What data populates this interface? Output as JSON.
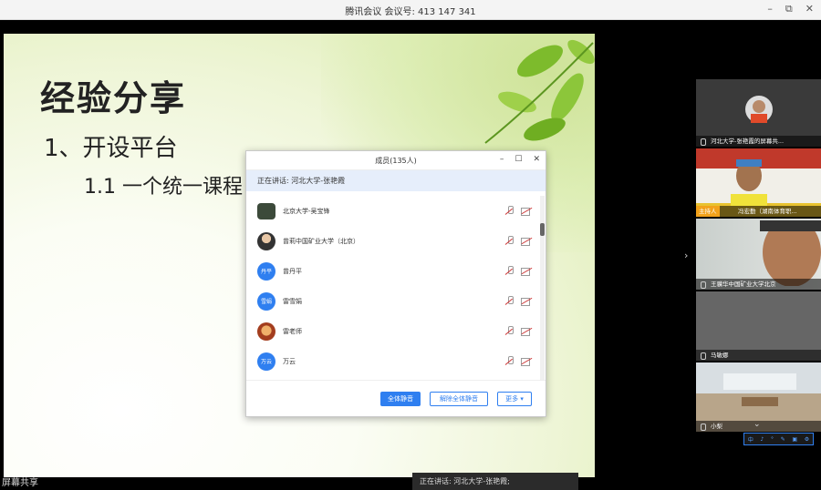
{
  "titlebar": {
    "title": "腾讯会议 会议号: 413 147 341",
    "minimize": "–",
    "restore": "⧉",
    "close": "✕"
  },
  "slide": {
    "heading": "经验分享",
    "line1": "1、开设平台",
    "line2": "1.1 一个统一课程"
  },
  "share_label": "屏幕共享",
  "speaking_bar": "正在讲话: 河北大学-张艳霞;",
  "members_panel": {
    "title": "成员(135人)",
    "speaking": "正在讲话: 河北大学-张艳霞",
    "members": [
      {
        "name": "北京大学-吴宝锋",
        "avatar": "photo1",
        "avatar_text": ""
      },
      {
        "name": "曾莉中国矿业大学（北京）",
        "avatar": "photo2",
        "avatar_text": ""
      },
      {
        "name": "曾丹平",
        "avatar": "blue",
        "avatar_text": "丹平"
      },
      {
        "name": "雷雪娟",
        "avatar": "blue",
        "avatar_text": "雪娟"
      },
      {
        "name": "雷老师",
        "avatar": "photo3",
        "avatar_text": ""
      },
      {
        "name": "万云",
        "avatar": "blue",
        "avatar_text": "万云"
      }
    ],
    "buttons": {
      "mute_all": "全体静音",
      "unmute_all": "解除全体静音",
      "more": "更多 ▾"
    }
  },
  "video_tiles": [
    {
      "label": "河北大学-张艳霞的屏幕共..."
    },
    {
      "label": "冯宏勤（湖南体育职...",
      "host_badge": "主持人"
    },
    {
      "label": "王骥华中国矿业大学北京"
    },
    {
      "label": "马敏娜"
    },
    {
      "label": "小梨"
    }
  ],
  "mini_toolbar": [
    "中",
    "♪",
    "°",
    "✎",
    "▣",
    "⚙"
  ],
  "colors": {
    "accent": "#2f7ff0",
    "host_badge": "#f2a21a"
  }
}
